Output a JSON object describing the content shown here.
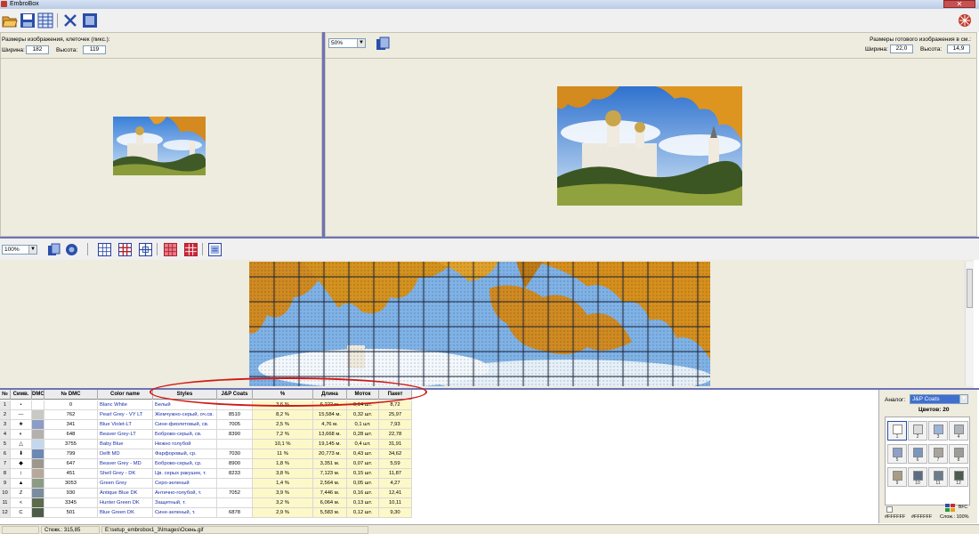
{
  "window": {
    "title": "EmbroBox",
    "close": "✕"
  },
  "toolbar": {
    "items": [
      {
        "name": "open-icon",
        "color": "#e1a032"
      },
      {
        "name": "save-icon",
        "color": "#2a4ea8"
      },
      {
        "name": "grid-table-icon",
        "color": "#2a4ea8"
      },
      {
        "name": "tools-icon",
        "color": "#2a4ea8"
      },
      {
        "name": "export-icon",
        "color": "#2a4ea8"
      }
    ]
  },
  "source_panel": {
    "heading": "Размеры изображения, клеточек (пикс.):",
    "width_label": "Ширина:",
    "width_value": "182",
    "height_label": "Высота:",
    "height_value": "119"
  },
  "result_panel": {
    "zoom": "50%",
    "heading": "Размеры готового изображения в см.:",
    "width_label": "Ширина:",
    "width_value": "22,0",
    "height_label": "Высота:",
    "height_value": "14,9"
  },
  "grid_toolbar": {
    "zoom": "100%"
  },
  "table": {
    "headers": [
      "№",
      "Симв.",
      "DMC",
      "№ DMC",
      "Color name",
      "Styles",
      "J&P Coats",
      "%",
      "Длина",
      "Моток",
      "Пакет"
    ],
    "rows": [
      [
        "1",
        "•",
        "#ffffff",
        "0",
        "Blanc White",
        "Белый",
        "",
        "3,6 %",
        "6,222 м.",
        "0,14 шт.",
        "8,72"
      ],
      [
        "2",
        "—",
        "#c8c8c4",
        "762",
        "Pearl Grey - VY LT",
        "Жемчужно-серый, оч.св.",
        "8510",
        "8,2 %",
        "15,584 м.",
        "0,32 шт.",
        "25,97"
      ],
      [
        "3",
        "★",
        "#8c9cc4",
        "341",
        "Blue Violet-LT",
        "Сине-фиолетовый, св.",
        "7005",
        "2,5 %",
        "4,76 м.",
        "0,1 шт.",
        "7,93"
      ],
      [
        "4",
        "◐",
        "#b4b0ac",
        "648",
        "Beaver Grey-LT",
        "Боброво-серый, св.",
        "8390",
        "7,2 %",
        "13,668 м.",
        "0,28 шт.",
        "22,78"
      ],
      [
        "5",
        "△",
        "#c4d8ec",
        "3755",
        "Baby Blue",
        "Нежно голубой",
        "",
        "10,1 %",
        "19,145 м.",
        "0,4 шт.",
        "31,91"
      ],
      [
        "6",
        "⬇",
        "#6c88b4",
        "799",
        "Delft MD",
        "Фарфоровый, ср.",
        "7030",
        "11 %",
        "20,773 м.",
        "0,43 шт.",
        "34,62"
      ],
      [
        "7",
        "◆",
        "#9c9890",
        "647",
        "Beaver Grey - MD",
        "Боброво-серый, ср.",
        "8900",
        "1,8 %",
        "3,351 м.",
        "0,07 шт.",
        "5,59"
      ],
      [
        "8",
        "↕",
        "#b8a89c",
        "451",
        "Shell Grey - DK",
        "Цв. серых ракушек, т.",
        "8233",
        "3,8 %",
        "7,123 м.",
        "0,15 шт.",
        "11,87"
      ],
      [
        "9",
        "▲",
        "#8c9c84",
        "3053",
        "Green Grey",
        "Серо-зеленый",
        "",
        "1,4 %",
        "2,564 м.",
        "0,05 шт.",
        "4,27"
      ],
      [
        "10",
        "Z",
        "#7c8ca0",
        "930",
        "Antique Blue DK",
        "Антично-голубой, т.",
        "7052",
        "3,9 %",
        "7,446 м.",
        "0,16 шт.",
        "12,41"
      ],
      [
        "11",
        "<",
        "#5c6c4c",
        "3345",
        "Hunter Green DK",
        "Защитный, т.",
        "",
        "3,2 %",
        "6,064 м.",
        "0,13 шт.",
        "10,11"
      ],
      [
        "12",
        "C",
        "#4c5c48",
        "501",
        "Blue Green DK",
        "Сине-зеленый, т.",
        "6878",
        "2,9 %",
        "5,583 м.",
        "0,12 шт.",
        "9,30"
      ]
    ]
  },
  "side_panel": {
    "analog_label": "Аналог:",
    "analog_value": "J&P Coats",
    "colors_label": "Цветов: 20",
    "palette": [
      {
        "n": "1",
        "c": "#ffffff"
      },
      {
        "n": "2",
        "c": "#dcdcdc"
      },
      {
        "n": "3",
        "c": "#9cb4d8"
      },
      {
        "n": "4",
        "c": "#b0b4bc"
      },
      {
        "n": "5",
        "c": "#8ca0c8"
      },
      {
        "n": "6",
        "c": "#7a96c0"
      },
      {
        "n": "7",
        "c": "#a8a49c"
      },
      {
        "n": "8",
        "c": "#9c9c98"
      },
      {
        "n": "9",
        "c": "#a89c84"
      },
      {
        "n": "10",
        "c": "#5c6c84"
      },
      {
        "n": "11",
        "c": "#6c7c8c"
      },
      {
        "n": "12",
        "c": "#4c5c50"
      }
    ],
    "hex_left": "#FFFFFF",
    "hex_right": "#FFFFFF",
    "complexity": "Слож.: 100%",
    "swatch_label": "BFC"
  },
  "status": {
    "stitches": "Стежк.: 315,85",
    "path": "E:\\setup_embrobox1_3\\Images\\Осень.gif"
  }
}
